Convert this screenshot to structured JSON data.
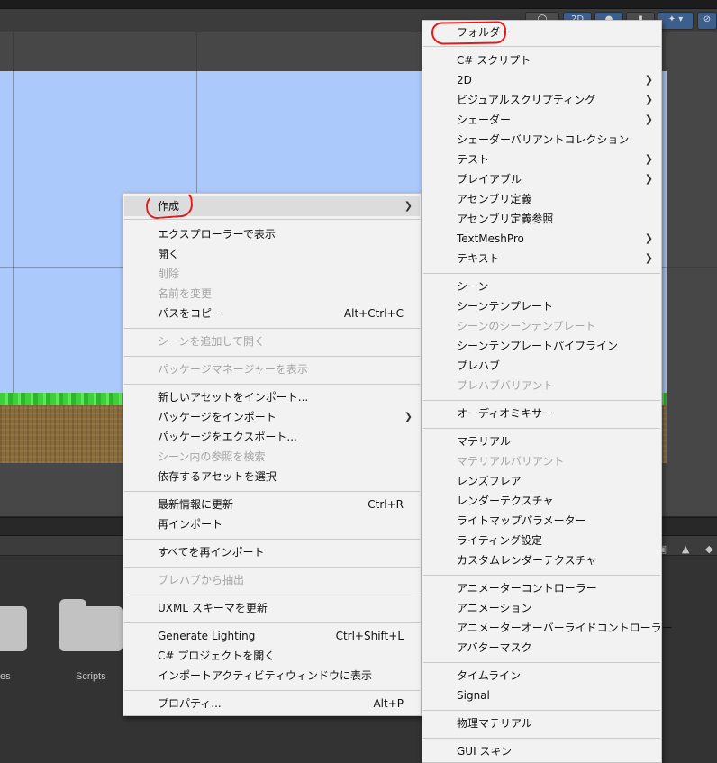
{
  "scene_toolbar": {
    "btn_2d": "2D"
  },
  "project_panel": {
    "folders": [
      {
        "label": "es"
      },
      {
        "label": "Scripts"
      }
    ]
  },
  "context_menu": {
    "items": [
      {
        "label": "作成",
        "shortcut": "",
        "submenu": true,
        "disabled": false
      },
      {
        "label": "エクスプローラーで表示",
        "shortcut": "",
        "submenu": false,
        "disabled": false
      },
      {
        "label": "開く",
        "shortcut": "",
        "submenu": false,
        "disabled": false
      },
      {
        "label": "削除",
        "shortcut": "",
        "submenu": false,
        "disabled": true
      },
      {
        "label": "名前を変更",
        "shortcut": "",
        "submenu": false,
        "disabled": true
      },
      {
        "label": "パスをコピー",
        "shortcut": "Alt+Ctrl+C",
        "submenu": false,
        "disabled": false
      },
      {
        "label": "シーンを追加して開く",
        "shortcut": "",
        "submenu": false,
        "disabled": true
      },
      {
        "label": "パッケージマネージャーを表示",
        "shortcut": "",
        "submenu": false,
        "disabled": true
      },
      {
        "label": "新しいアセットをインポート...",
        "shortcut": "",
        "submenu": false,
        "disabled": false
      },
      {
        "label": "パッケージをインポート",
        "shortcut": "",
        "submenu": true,
        "disabled": false
      },
      {
        "label": "パッケージをエクスポート...",
        "shortcut": "",
        "submenu": false,
        "disabled": false
      },
      {
        "label": "シーン内の参照を検索",
        "shortcut": "",
        "submenu": false,
        "disabled": true
      },
      {
        "label": "依存するアセットを選択",
        "shortcut": "",
        "submenu": false,
        "disabled": false
      },
      {
        "label": "最新情報に更新",
        "shortcut": "Ctrl+R",
        "submenu": false,
        "disabled": false
      },
      {
        "label": "再インポート",
        "shortcut": "",
        "submenu": false,
        "disabled": false
      },
      {
        "label": "すべてを再インポート",
        "shortcut": "",
        "submenu": false,
        "disabled": false
      },
      {
        "label": "プレハブから抽出",
        "shortcut": "",
        "submenu": false,
        "disabled": true
      },
      {
        "label": "UXML スキーマを更新",
        "shortcut": "",
        "submenu": false,
        "disabled": false
      },
      {
        "label": "Generate Lighting",
        "shortcut": "Ctrl+Shift+L",
        "submenu": false,
        "disabled": false
      },
      {
        "label": "C# プロジェクトを開く",
        "shortcut": "",
        "submenu": false,
        "disabled": false
      },
      {
        "label": "インポートアクティビティウィンドウに表示",
        "shortcut": "",
        "submenu": false,
        "disabled": false
      },
      {
        "label": "プロパティ...",
        "shortcut": "Alt+P",
        "submenu": false,
        "disabled": false
      }
    ]
  },
  "create_submenu": {
    "items": [
      {
        "label": "フォルダー",
        "submenu": false,
        "disabled": false
      },
      {
        "label": "C# スクリプト",
        "submenu": false,
        "disabled": false
      },
      {
        "label": "2D",
        "submenu": true,
        "disabled": false
      },
      {
        "label": "ビジュアルスクリプティング",
        "submenu": true,
        "disabled": false
      },
      {
        "label": "シェーダー",
        "submenu": true,
        "disabled": false
      },
      {
        "label": "シェーダーバリアントコレクション",
        "submenu": false,
        "disabled": false
      },
      {
        "label": "テスト",
        "submenu": true,
        "disabled": false
      },
      {
        "label": "プレイアブル",
        "submenu": true,
        "disabled": false
      },
      {
        "label": "アセンブリ定義",
        "submenu": false,
        "disabled": false
      },
      {
        "label": "アセンブリ定義参照",
        "submenu": false,
        "disabled": false
      },
      {
        "label": "TextMeshPro",
        "submenu": true,
        "disabled": false
      },
      {
        "label": "テキスト",
        "submenu": true,
        "disabled": false
      },
      {
        "label": "シーン",
        "submenu": false,
        "disabled": false
      },
      {
        "label": "シーンテンプレート",
        "submenu": false,
        "disabled": false
      },
      {
        "label": "シーンのシーンテンプレート",
        "submenu": false,
        "disabled": true
      },
      {
        "label": "シーンテンプレートパイプライン",
        "submenu": false,
        "disabled": false
      },
      {
        "label": "プレハブ",
        "submenu": false,
        "disabled": false
      },
      {
        "label": "プレハブバリアント",
        "submenu": false,
        "disabled": true
      },
      {
        "label": "オーディオミキサー",
        "submenu": false,
        "disabled": false
      },
      {
        "label": "マテリアル",
        "submenu": false,
        "disabled": false
      },
      {
        "label": "マテリアルバリアント",
        "submenu": false,
        "disabled": true
      },
      {
        "label": "レンズフレア",
        "submenu": false,
        "disabled": false
      },
      {
        "label": "レンダーテクスチャ",
        "submenu": false,
        "disabled": false
      },
      {
        "label": "ライトマップパラメーター",
        "submenu": false,
        "disabled": false
      },
      {
        "label": "ライティング設定",
        "submenu": false,
        "disabled": false
      },
      {
        "label": "カスタムレンダーテクスチャ",
        "submenu": false,
        "disabled": false
      },
      {
        "label": "アニメーターコントローラー",
        "submenu": false,
        "disabled": false
      },
      {
        "label": "アニメーション",
        "submenu": false,
        "disabled": false
      },
      {
        "label": "アニメーターオーバーライドコントローラー",
        "submenu": false,
        "disabled": false
      },
      {
        "label": "アバターマスク",
        "submenu": false,
        "disabled": false
      },
      {
        "label": "タイムライン",
        "submenu": false,
        "disabled": false
      },
      {
        "label": "Signal",
        "submenu": false,
        "disabled": false
      },
      {
        "label": "物理マテリアル",
        "submenu": false,
        "disabled": false
      },
      {
        "label": "GUI スキン",
        "submenu": false,
        "disabled": false
      }
    ]
  },
  "icons": {
    "submenu_arrow": "chevron-right-icon",
    "project_toolbar": [
      "lock-icon",
      "filter-icon",
      "tag-icon"
    ]
  },
  "colors": {
    "menu_bg": "#f2f2f2",
    "highlight": "#dcdcdc",
    "disabled_text": "#a5a5a5",
    "annotation_red": "#e21c1c",
    "scene_sky": "#abc9fb"
  }
}
